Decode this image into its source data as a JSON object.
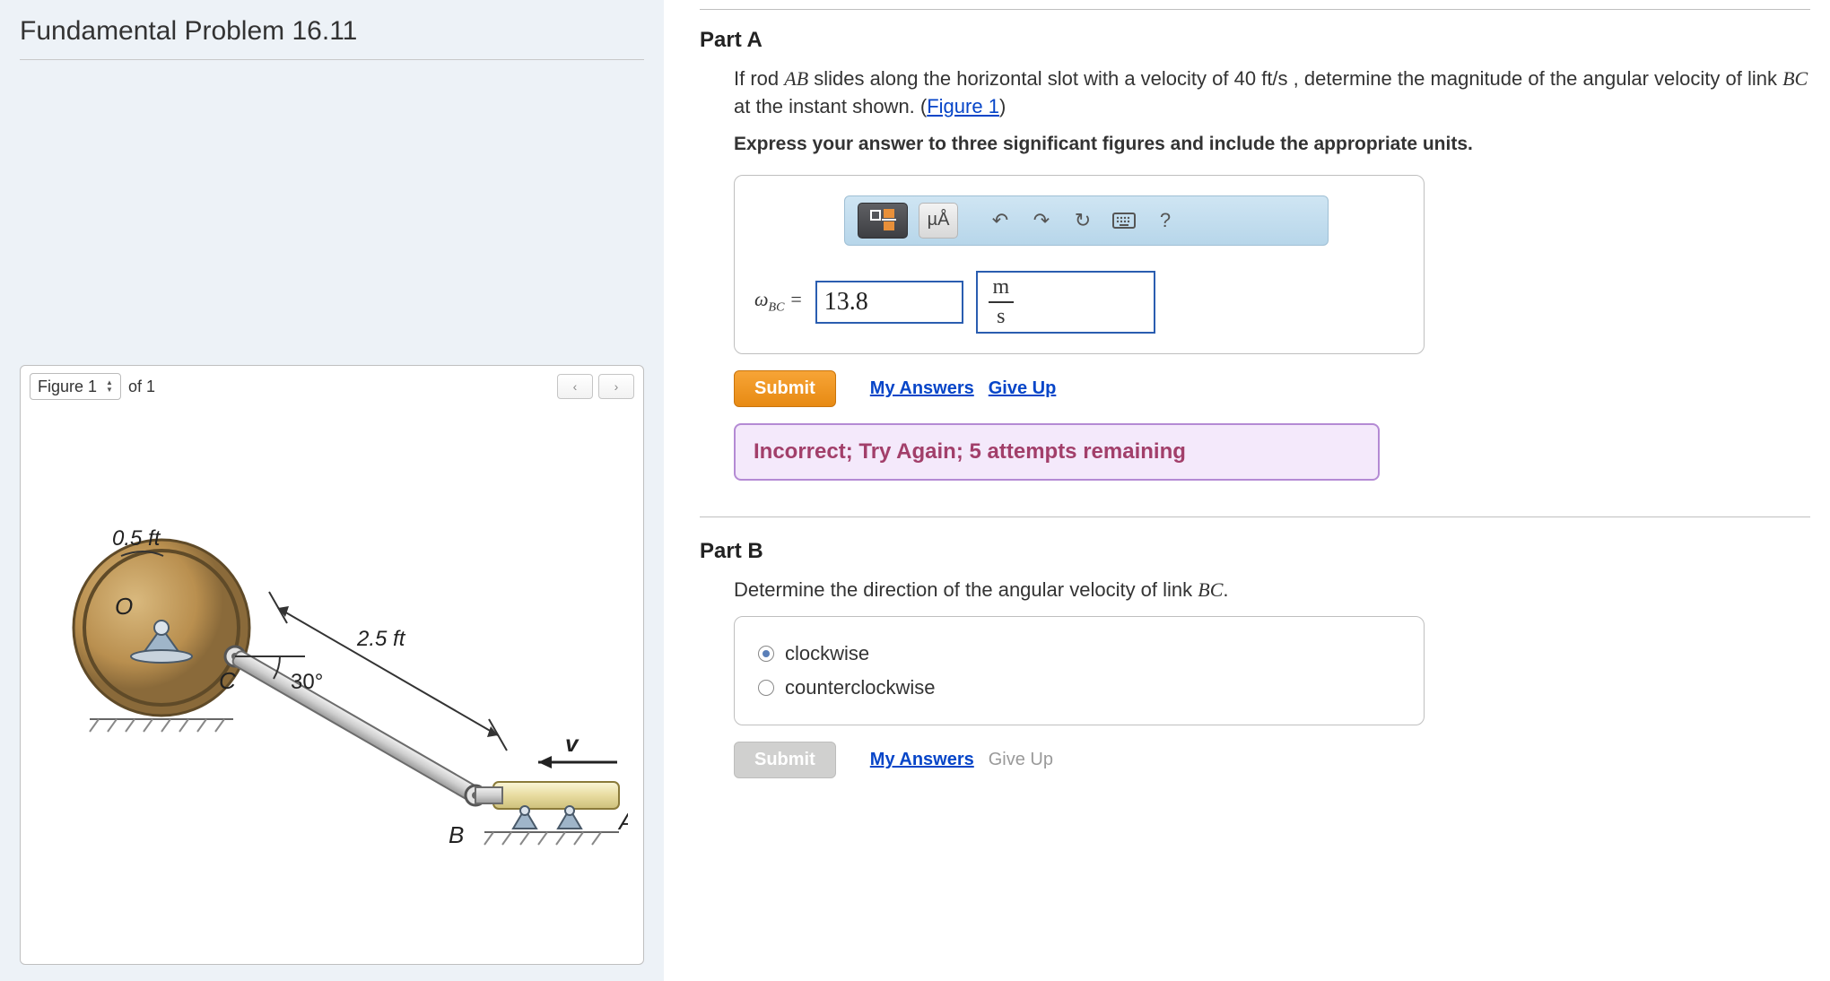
{
  "problem": {
    "title": "Fundamental Problem 16.11"
  },
  "figure": {
    "selector_label": "Figure 1",
    "of_label": "of 1",
    "diagram": {
      "radius_label": "0.5 ft",
      "origin_label": "O",
      "point_c": "C",
      "angle_label": "30°",
      "link_length_label": "2.5 ft",
      "velocity_label": "v",
      "point_b": "B",
      "point_a": "A"
    }
  },
  "partA": {
    "title": "Part A",
    "question_pre": "If rod ",
    "question_rod1": "AB",
    "question_mid1": " slides along the horizontal slot with a velocity of 40 ",
    "question_unit": "ft/s",
    "question_mid2": " , determine the magnitude of the angular velocity of link ",
    "question_rod2": "BC",
    "question_mid3": " at the instant shown. (",
    "figure_link": "Figure 1",
    "question_post": ")",
    "instruction": "Express your answer to three significant figures and include the appropriate units.",
    "toolbar": {
      "mua": "µÅ",
      "help": "?"
    },
    "answer": {
      "label_main": "ω",
      "label_sub": "BC",
      "label_eq": " = ",
      "value": "13.8",
      "unit_num": "m",
      "unit_den": "s"
    },
    "submit_label": "Submit",
    "my_answers": "My Answers",
    "give_up": "Give Up",
    "feedback": "Incorrect; Try Again; 5 attempts remaining"
  },
  "partB": {
    "title": "Part B",
    "question_pre": "Determine the direction of the angular velocity of link ",
    "question_link": "BC",
    "question_post": ".",
    "options": [
      {
        "label": "clockwise",
        "selected": true
      },
      {
        "label": "counterclockwise",
        "selected": false
      }
    ],
    "submit_label": "Submit",
    "my_answers": "My Answers",
    "give_up": "Give Up"
  }
}
